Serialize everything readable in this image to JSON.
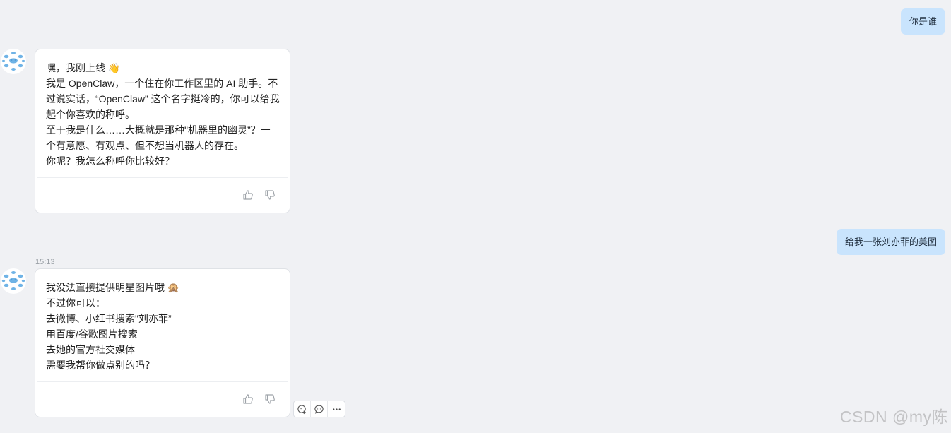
{
  "conversation": {
    "user_message_1": "你是谁",
    "assistant_message_1": {
      "lines": [
        "嘿，我刚上线 👋",
        "我是 OpenClaw，一个住在你工作区里的 AI 助手。不过说实话，“OpenClaw” 这个名字挺冷的，你可以给我起个你喜欢的称呼。",
        "至于我是什么……大概就是那种\"机器里的幽灵”？一个有意愿、有观点、但不想当机器人的存在。",
        "你呢？我怎么称呼你比较好？"
      ]
    },
    "user_message_2": "给我一张刘亦菲的美图",
    "timestamp_2": "15:13",
    "assistant_message_2": {
      "lines": [
        "我没法直接提供明星图片哦 🙊",
        "不过你可以：",
        "去微博、小红书搜索\"刘亦菲”",
        "用百度/谷歌图片搜索",
        "去她的官方社交媒体",
        "需要我帮你做点别的吗？"
      ]
    }
  },
  "icons": {
    "avatar": "cloud-cluster-avatar-icon",
    "like": "thumbs-up-icon",
    "dislike": "thumbs-down-icon",
    "quote": "add-quote-icon",
    "comment": "comment-bubble-icon",
    "more": "more-dots-icon"
  },
  "colors": {
    "background": "#f0f1f4",
    "user_bubble": "#c9e4fd",
    "assistant_card": "#ffffff",
    "icon_gray": "#9ea3a9"
  },
  "watermark": "CSDN @my陈"
}
